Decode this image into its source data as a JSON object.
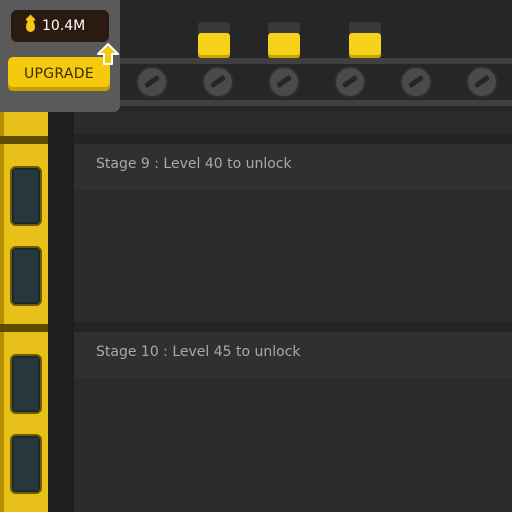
{
  "currency": {
    "amount": "10.4M",
    "icon": "oil-drop-icon",
    "color": "#f5c518"
  },
  "upgrade": {
    "label": "UPGRADE",
    "color": "#f5ca0e"
  },
  "stages": [
    {
      "label": "Stage 9 : Level 40 to unlock"
    },
    {
      "label": "Stage 10 : Level 45 to unlock"
    }
  ],
  "colors": {
    "tower": "#e7c11a",
    "crate": "#f7d21a",
    "background": "#242424"
  }
}
